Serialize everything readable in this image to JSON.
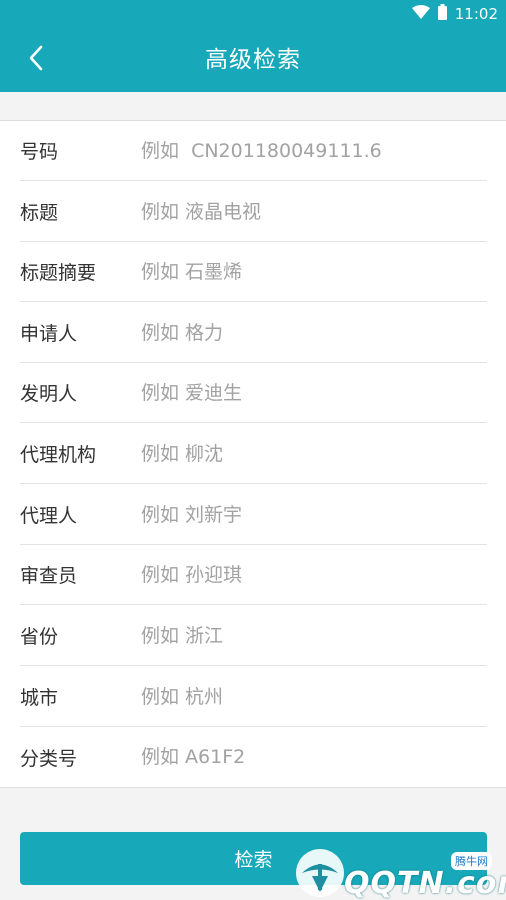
{
  "status_bar": {
    "time": "11:02",
    "icons": [
      "wifi-icon",
      "battery-icon"
    ]
  },
  "header": {
    "title": "高级检索",
    "back_icon": "chevron-left-icon"
  },
  "form": {
    "fields": [
      {
        "label": "号码",
        "placeholder": "例如  CN201180049111.6",
        "value": ""
      },
      {
        "label": "标题",
        "placeholder": "例如 液晶电视",
        "value": ""
      },
      {
        "label": "标题摘要",
        "placeholder": "例如 石墨烯",
        "value": ""
      },
      {
        "label": "申请人",
        "placeholder": "例如 格力",
        "value": ""
      },
      {
        "label": "发明人",
        "placeholder": "例如 爱迪生",
        "value": ""
      },
      {
        "label": "代理机构",
        "placeholder": "例如 柳沈",
        "value": ""
      },
      {
        "label": "代理人",
        "placeholder": "例如 刘新宇",
        "value": ""
      },
      {
        "label": "审查员",
        "placeholder": "例如 孙迎琪",
        "value": ""
      },
      {
        "label": "省份",
        "placeholder": "例如 浙江",
        "value": ""
      },
      {
        "label": "城市",
        "placeholder": "例如 杭州",
        "value": ""
      },
      {
        "label": "分类号",
        "placeholder": "例如 A61F2",
        "value": ""
      }
    ]
  },
  "search_button": {
    "label": "检索"
  },
  "watermark": {
    "text": "QQTN.com",
    "badge": "腾牛网"
  },
  "colors": {
    "accent": "#17a9b9",
    "background": "#f3f3f3",
    "placeholder": "#a2a2a2",
    "label": "#333333"
  }
}
